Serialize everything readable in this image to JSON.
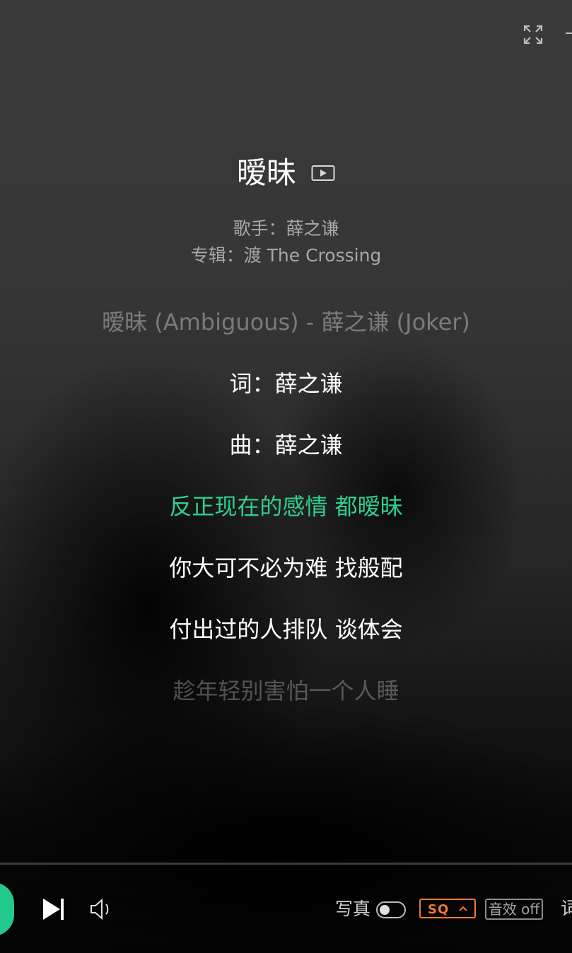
{
  "song": {
    "title": "暧昧",
    "singer_line": "歌手：薛之谦",
    "album_line": "专辑：渡 The Crossing"
  },
  "lyrics": {
    "lines": [
      "暧昧 (Ambiguous) - 薛之谦 (Joker)",
      "词：薛之谦",
      "曲：薛之谦",
      "反正现在的感情 都暧昧",
      "你大可不必为难 找般配",
      "付出过的人排队 谈体会",
      "趁年轻别害怕一个人睡"
    ],
    "active_index": 3
  },
  "controls": {
    "photo_label": "写真",
    "photo_toggle_on": false,
    "quality_label": "SQ",
    "effect_label": "音效 off",
    "lyric_label": "词"
  },
  "colors": {
    "accent": "#2ecf8f",
    "quality": "#f07a2c"
  },
  "icons": [
    "expand-icon",
    "minimize-icon",
    "mv-play-icon",
    "play-icon",
    "next-icon",
    "volume-icon",
    "chevron-up-icon"
  ]
}
